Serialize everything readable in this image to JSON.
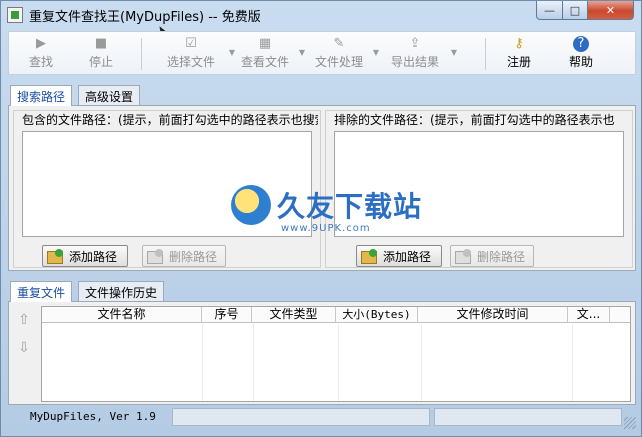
{
  "window": {
    "title": "重复文件查找王(MyDupFiles) -- 免费版",
    "minimize": "—",
    "maximize": "□",
    "close": "✕"
  },
  "toolbar": {
    "items": [
      {
        "label": "查找",
        "icon": "play-icon",
        "glyph": "▶"
      },
      {
        "label": "停止",
        "icon": "stop-icon",
        "glyph": "■"
      },
      {
        "label": "选择文件",
        "icon": "select-files-icon",
        "glyph": "☑"
      },
      {
        "label": "查看文件",
        "icon": "view-files-icon",
        "glyph": "▦"
      },
      {
        "label": "文件处理",
        "icon": "file-process-icon",
        "glyph": "✎"
      },
      {
        "label": "导出结果",
        "icon": "export-icon",
        "glyph": "⇪"
      },
      {
        "label": "注册",
        "icon": "key-icon",
        "glyph": "⚷"
      },
      {
        "label": "帮助",
        "icon": "help-icon",
        "glyph": "?"
      }
    ]
  },
  "tabs": {
    "search_path": "搜索路径",
    "advanced": "高级设置"
  },
  "include_group": {
    "label": "包含的文件路径：(提示，前面打勾选中的路径表示也搜索",
    "add_button": "添加路径",
    "delete_button": "删除路径"
  },
  "exclude_group": {
    "label": "排除的文件路径：(提示，前面打勾选中的路径表示也",
    "add_button": "添加路径",
    "delete_button": "删除路径"
  },
  "watermark": {
    "main": "久友下载站",
    "url": "www.9UPK.com"
  },
  "results_tabs": {
    "duplicates": "重复文件",
    "history": "文件操作历史"
  },
  "results_grid": {
    "columns": [
      "文件名称",
      "序号",
      "文件类型",
      "大小(Bytes)",
      "文件修改时间",
      "文..."
    ]
  },
  "statusbar": {
    "version": "MyDupFiles, Ver 1.9"
  }
}
